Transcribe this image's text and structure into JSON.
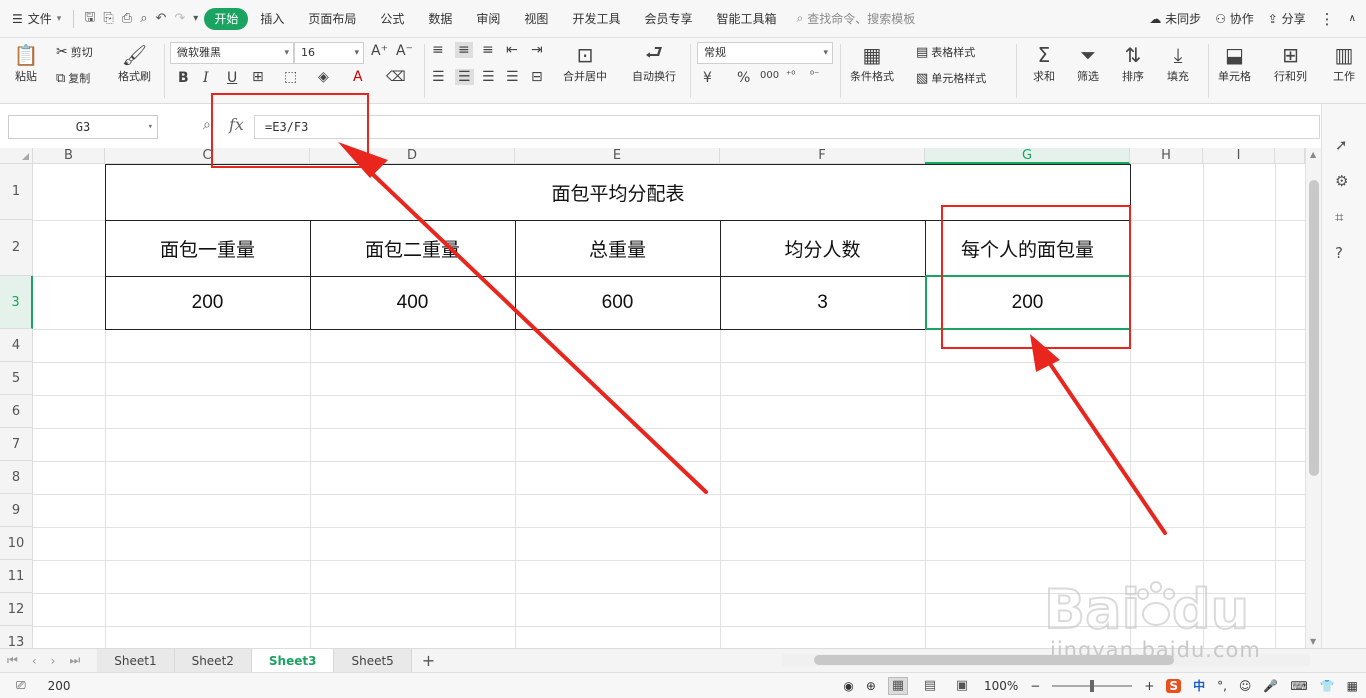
{
  "menu": {
    "file_label": "文件",
    "tabs": [
      "开始",
      "插入",
      "页面布局",
      "公式",
      "数据",
      "审阅",
      "视图",
      "开发工具",
      "会员专享",
      "智能工具箱"
    ],
    "active_tab": "开始",
    "search_placeholder": "查找命令、搜索模板",
    "sync_label": "未同步",
    "collab_label": "协作",
    "share_label": "分享"
  },
  "ribbon": {
    "paste": "粘贴",
    "cut": "剪切",
    "copy": "复制",
    "format_painter": "格式刷",
    "font_name": "微软雅黑",
    "font_size": "16",
    "merge_center": "合并居中",
    "wrap_text": "自动换行",
    "number_format": "常规",
    "conditional_format": "条件格式",
    "table_style": "表格样式",
    "cell_style": "单元格样式",
    "sum": "求和",
    "filter": "筛选",
    "sort": "排序",
    "fill": "填充",
    "cell": "单元格",
    "row_col": "行和列",
    "worksheet": "工作"
  },
  "formula_bar": {
    "cell_ref": "G3",
    "fx_label": "fx",
    "formula": "=E3/F3"
  },
  "columns": [
    "B",
    "C",
    "D",
    "E",
    "F",
    "G",
    "H",
    "I"
  ],
  "selected_column": "G",
  "rows": [
    "1",
    "2",
    "3",
    "4",
    "5",
    "6",
    "7",
    "8",
    "9",
    "10",
    "11",
    "12",
    "13"
  ],
  "selected_row": "3",
  "table": {
    "title": "面包平均分配表",
    "headers": [
      "面包一重量",
      "面包二重量",
      "总重量",
      "均分人数",
      "每个人的面包量"
    ],
    "values": [
      "200",
      "400",
      "600",
      "3",
      "200"
    ]
  },
  "sheets": [
    "Sheet1",
    "Sheet2",
    "Sheet3",
    "Sheet5"
  ],
  "active_sheet": "Sheet3",
  "status": {
    "value": "200",
    "zoom": "100%"
  },
  "ime": {
    "lang": "中"
  },
  "watermark": {
    "logo_text": "Baidu经验",
    "url": "jingyan.baidu.com"
  },
  "colors": {
    "accent": "#1aa361",
    "annotation": "#e8261e"
  }
}
